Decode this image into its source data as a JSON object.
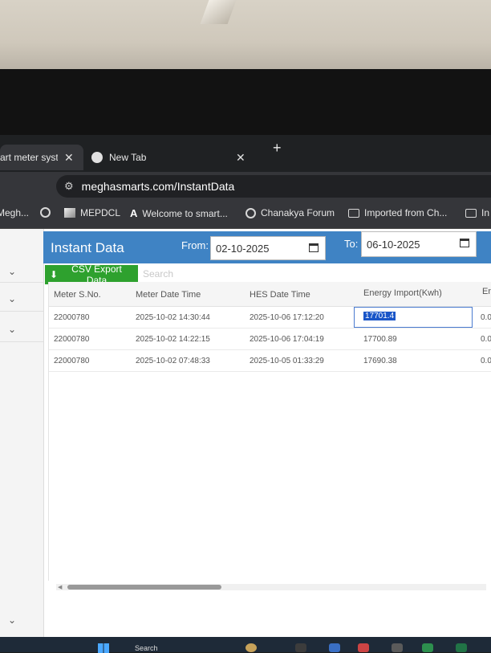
{
  "browser": {
    "tabs": [
      {
        "label": "art meter syste",
        "active": true
      },
      {
        "label": "New Tab",
        "active": false
      }
    ],
    "new_tab_symbol": "+",
    "close_symbol": "✕",
    "url": "meghasmarts.com/InstantData",
    "bookmarks": [
      {
        "label": "Megh...",
        "icon": "globe-icon"
      },
      {
        "label": "",
        "icon": "globe-icon"
      },
      {
        "label": "MEPDCL",
        "icon": "mepdcl-logo-icon"
      },
      {
        "label": "Welcome to smart...",
        "icon": "letter-a-icon"
      },
      {
        "label": "Chanakya Forum",
        "icon": "globe-icon"
      },
      {
        "label": "Imported from Ch...",
        "icon": "folder-icon"
      },
      {
        "label": "In",
        "icon": "folder-icon"
      }
    ]
  },
  "page": {
    "title": "Instant Data",
    "from_label": "From:",
    "from_date": "02-10-2025",
    "to_label": "To:",
    "to_date": "06-10-2025",
    "csv_button": "CSV Export Data",
    "search_placeholder": "Search",
    "columns": [
      "Meter S.No.",
      "Meter Date Time",
      "HES Date Time",
      "Energy Import(Kwh)",
      "En"
    ],
    "rows": [
      {
        "meter": "22000780",
        "meter_dt": "2025-10-02 14:30:44",
        "hes_dt": "2025-10-06 17:12:20",
        "energy": "17701.4",
        "extra": "0.0"
      },
      {
        "meter": "22000780",
        "meter_dt": "2025-10-02 14:22:15",
        "hes_dt": "2025-10-06 17:04:19",
        "energy": "17700.89",
        "extra": "0.0"
      },
      {
        "meter": "22000780",
        "meter_dt": "2025-10-02 07:48:33",
        "hes_dt": "2025-10-05 01:33:29",
        "energy": "17690.38",
        "extra": "0.0"
      }
    ]
  },
  "taskbar": {
    "search_label": "Search"
  },
  "colors": {
    "header": "#3f83c4",
    "csv_button": "#2ea12e",
    "selection": "#1a56c8"
  }
}
